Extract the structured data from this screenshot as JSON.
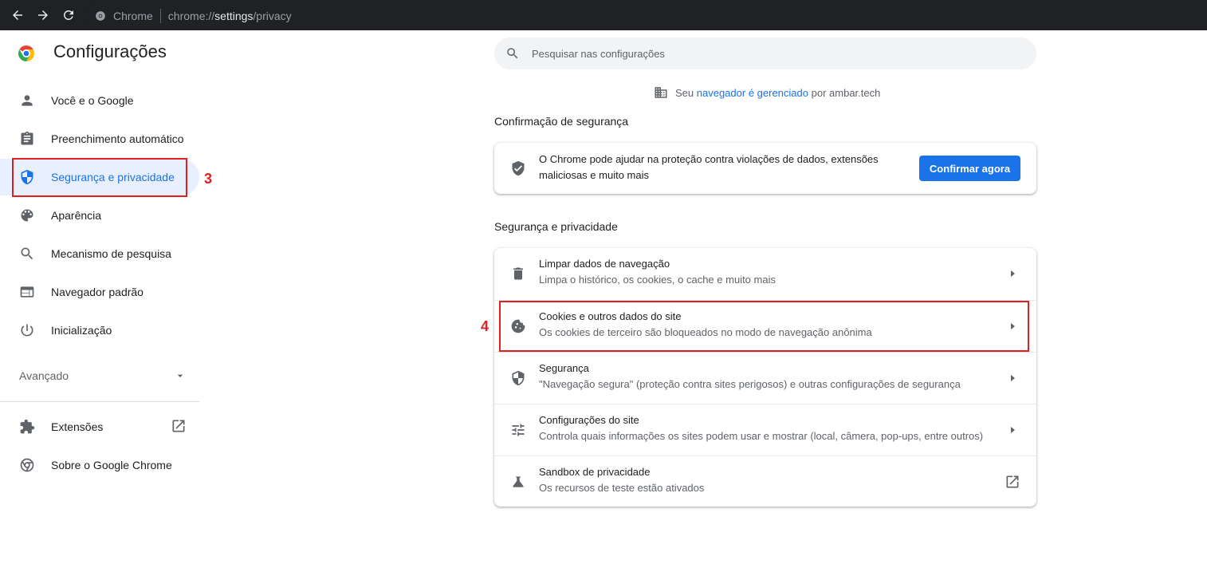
{
  "browser": {
    "site_name": "Chrome",
    "url_prefix": "chrome://",
    "url_host": "settings",
    "url_path": "/privacy"
  },
  "sidebar": {
    "title": "Configurações",
    "items": [
      {
        "label": "Você e o Google",
        "icon": "person-icon"
      },
      {
        "label": "Preenchimento automático",
        "icon": "clipboard-icon"
      },
      {
        "label": "Segurança e privacidade",
        "icon": "shield-icon",
        "active": true
      },
      {
        "label": "Aparência",
        "icon": "palette-icon"
      },
      {
        "label": "Mecanismo de pesquisa",
        "icon": "search-icon"
      },
      {
        "label": "Navegador padrão",
        "icon": "browser-window-icon"
      },
      {
        "label": "Inicialização",
        "icon": "power-icon"
      }
    ],
    "advanced_label": "Avançado",
    "extensions_label": "Extensões",
    "about_label": "Sobre o Google Chrome"
  },
  "search": {
    "placeholder": "Pesquisar nas configurações"
  },
  "managed": {
    "prefix": "Seu",
    "link": "navegador é gerenciado",
    "suffix": "por ambar.tech"
  },
  "safety_check": {
    "heading": "Confirmação de segurança",
    "text": "O Chrome pode ajudar na proteção contra violações de dados, extensões maliciosas e muito mais",
    "button_label": "Confirmar agora"
  },
  "privacy": {
    "heading": "Segurança e privacidade",
    "rows": [
      {
        "title": "Limpar dados de navegação",
        "subtitle": "Limpa o histórico, os cookies, o cache e muito mais",
        "icon": "trash-icon"
      },
      {
        "title": "Cookies e outros dados do site",
        "subtitle": "Os cookies de terceiro são bloqueados no modo de navegação anônima",
        "icon": "cookie-icon"
      },
      {
        "title": "Segurança",
        "subtitle": "\"Navegação segura\" (proteção contra sites perigosos) e outras configurações de segurança",
        "icon": "shield-icon"
      },
      {
        "title": "Configurações do site",
        "subtitle": "Controla quais informações os sites podem usar e mostrar (local, câmera, pop-ups, entre outros)",
        "icon": "tune-icon"
      },
      {
        "title": "Sandbox de privacidade",
        "subtitle": "Os recursos de teste estão ativados",
        "icon": "flask-icon"
      }
    ]
  },
  "annotations": {
    "step_3": "3",
    "step_4": "4",
    "color": "#e02020"
  },
  "colors": {
    "accent": "#1a73e8",
    "active_bg": "#e8f0fe",
    "topbar": "#202124"
  }
}
